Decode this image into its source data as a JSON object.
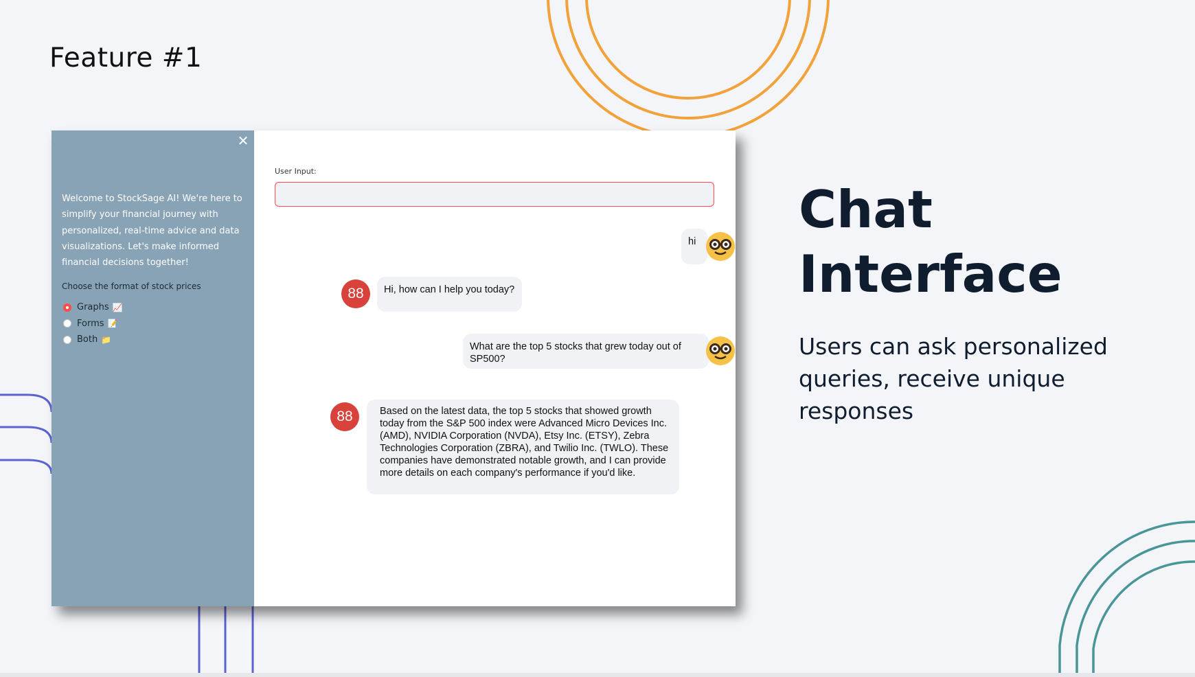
{
  "slide": {
    "feature_label": "Feature #1",
    "heading": "Chat Interface",
    "description": "Users can ask personalized queries, receive unique responses"
  },
  "colors": {
    "background": "#f4f5f9",
    "sidebar": "#87a3b5",
    "accent_red": "#ff4b4b",
    "bot_avatar": "#d9423a",
    "bubble": "#f0f2f6",
    "deco_orange": "#f2a23a",
    "deco_blue": "#5b63d3",
    "deco_teal": "#4a9597"
  },
  "sidebar": {
    "close_icon": "close-icon",
    "welcome_text": "Welcome to StockSage AI! We're here to simplify your financial journey with personalized, real-time advice and data visualizations. Let's make informed financial decisions together!",
    "format_label": "Choose the format of stock prices",
    "options": [
      {
        "label": "Graphs",
        "emoji": "📈",
        "selected": true
      },
      {
        "label": "Forms",
        "emoji": "📝",
        "selected": false
      },
      {
        "label": "Both",
        "emoji": "📁",
        "selected": false
      }
    ]
  },
  "main": {
    "input_label": "User Input:",
    "input_value": "",
    "input_placeholder": "",
    "messages": [
      {
        "role": "user",
        "text": "hi",
        "avatar": "nerd-face-icon"
      },
      {
        "role": "bot",
        "text": "Hi, how can I help you today?",
        "avatar": "88"
      },
      {
        "role": "user",
        "text": "What are the top 5 stocks that grew today out of SP500?",
        "avatar": "nerd-face-icon"
      },
      {
        "role": "bot",
        "text": "Based on the latest data, the top 5 stocks that showed growth today from the S&P 500 index were Advanced Micro Devices Inc. (AMD), NVIDIA Corporation (NVDA), Etsy Inc. (ETSY), Zebra Technologies Corporation (ZBRA), and Twilio Inc. (TWLO). These companies have demonstrated notable growth, and I can provide more details on each company's performance if you'd like.",
        "avatar": "88"
      }
    ]
  }
}
